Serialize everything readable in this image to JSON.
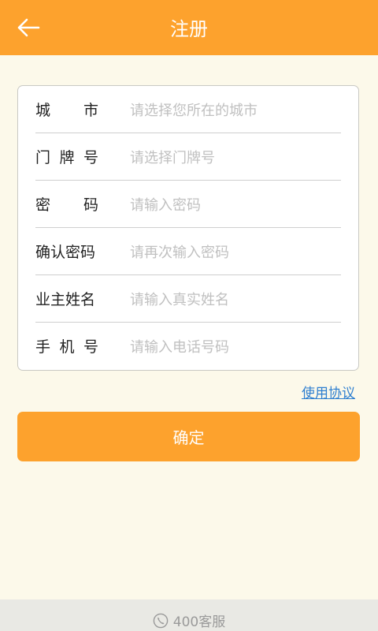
{
  "header": {
    "title": "注册",
    "back_icon": "arrow-left-icon"
  },
  "form": {
    "fields": [
      {
        "label_chars": [
          "城",
          "市"
        ],
        "placeholder": "请选择您所在的城市"
      },
      {
        "label_chars": [
          "门",
          "牌",
          "号"
        ],
        "placeholder": "请选择门牌号"
      },
      {
        "label_chars": [
          "密",
          "码"
        ],
        "placeholder": "请输入密码"
      },
      {
        "label": "确认密码",
        "placeholder": "请再次输入密码"
      },
      {
        "label": "业主姓名",
        "placeholder": "请输入真实姓名"
      },
      {
        "label_chars": [
          "手",
          "机",
          "号"
        ],
        "placeholder": "请输入电话号码"
      }
    ]
  },
  "agreement_link": "使用协议",
  "confirm_button": "确定",
  "footer": {
    "support_text": "400客服",
    "support_icon": "phone-icon"
  },
  "colors": {
    "accent": "#fda22d",
    "background": "#fcf9ea",
    "link": "#2f7fd0"
  }
}
